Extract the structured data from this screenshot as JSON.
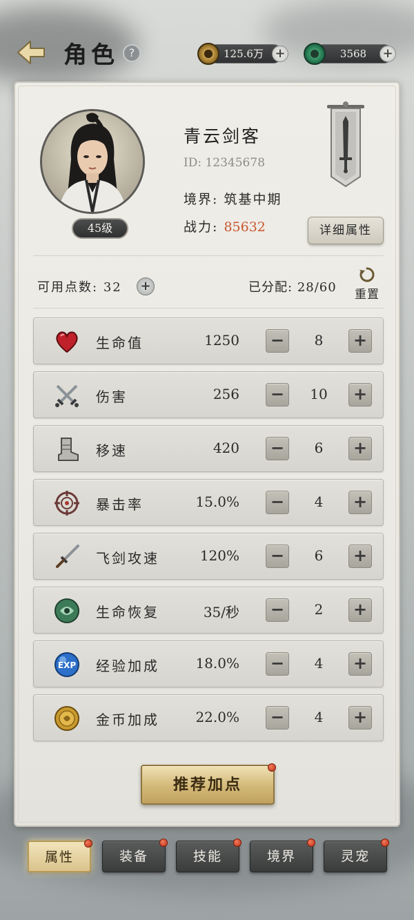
{
  "header": {
    "title": "角色",
    "help_glyph": "?",
    "gold": {
      "value": "125.6万",
      "plus": "+"
    },
    "jade": {
      "value": "3568",
      "plus": "+"
    }
  },
  "character": {
    "name": "青云剑客",
    "id_text": "ID: 12345678",
    "level_text": "45级",
    "realm_label": "境界:",
    "realm_value": "筑基中期",
    "power_label": "战力:",
    "power_value": "85632",
    "detail_button": "详细属性"
  },
  "points": {
    "available_label": "可用点数:",
    "available_value": "32",
    "plus": "+",
    "allocated_label": "已分配:",
    "allocated_value": "28/60",
    "reset_label": "重置"
  },
  "stats": [
    {
      "icon": "heart-icon",
      "name": "生命值",
      "value": "1250",
      "alloc": "8"
    },
    {
      "icon": "crossed-swords-icon",
      "name": "伤害",
      "value": "256",
      "alloc": "10"
    },
    {
      "icon": "boot-icon",
      "name": "移速",
      "value": "420",
      "alloc": "6"
    },
    {
      "icon": "crosshair-icon",
      "name": "暴击率",
      "value": "15.0%",
      "alloc": "4"
    },
    {
      "icon": "flying-sword-icon",
      "name": "飞剑攻速",
      "value": "120%",
      "alloc": "6"
    },
    {
      "icon": "jade-orb-icon",
      "name": "生命恢复",
      "value": "35/秒",
      "alloc": "2"
    },
    {
      "icon": "exp-orb-icon",
      "name": "经验加成",
      "value": "18.0%",
      "alloc": "4"
    },
    {
      "icon": "gold-coin-icon",
      "name": "金币加成",
      "value": "22.0%",
      "alloc": "4"
    }
  ],
  "stat_controls": {
    "minus": "−",
    "plus": "+"
  },
  "exp_icon_text": "EXP",
  "recommend_button": "推荐加点",
  "tabs": [
    {
      "label": "属性",
      "active": true
    },
    {
      "label": "装备",
      "active": false
    },
    {
      "label": "技能",
      "active": false
    },
    {
      "label": "境界",
      "active": false
    },
    {
      "label": "灵宠",
      "active": false
    }
  ],
  "colors": {
    "power_value": "#c8562f",
    "gold_button": "#d3b878",
    "notification_dot": "#c23216"
  }
}
